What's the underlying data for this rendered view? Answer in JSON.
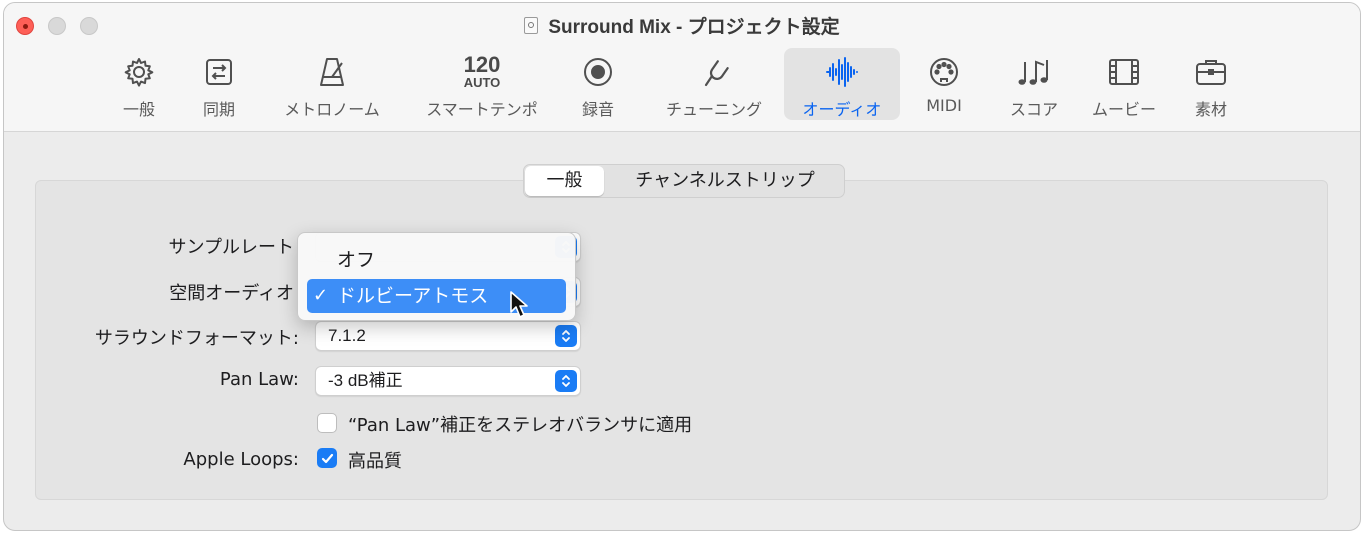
{
  "window": {
    "title": "Surround Mix - プロジェクト設定"
  },
  "toolbar": {
    "tabs": [
      {
        "label": "一般",
        "icon": "gear-icon"
      },
      {
        "label": "同期",
        "icon": "sync-icon"
      },
      {
        "label": "メトロノーム",
        "icon": "metronome-icon"
      },
      {
        "label": "スマートテンポ",
        "icon": "tempo-icon",
        "tempo_value": "120",
        "tempo_mode": "AUTO"
      },
      {
        "label": "録音",
        "icon": "record-icon"
      },
      {
        "label": "チューニング",
        "icon": "tuning-fork-icon"
      },
      {
        "label": "オーディオ",
        "icon": "waveform-icon",
        "active": true
      },
      {
        "label": "MIDI",
        "icon": "midi-connector-icon"
      },
      {
        "label": "スコア",
        "icon": "music-notes-icon"
      },
      {
        "label": "ムービー",
        "icon": "film-icon"
      },
      {
        "label": "素材",
        "icon": "briefcase-icon"
      }
    ]
  },
  "segmented": {
    "options": [
      "一般",
      "チャンネルストリップ"
    ],
    "selected": "一般"
  },
  "form": {
    "sample_rate_label": "サンプルレート",
    "spatial_audio_label": "空間オーディオ",
    "surround_format_label": "サラウンドフォーマット:",
    "surround_format_value": "7.1.2",
    "pan_law_label": "Pan Law:",
    "pan_law_value": "-3 dB補正",
    "pan_law_stereo_label": "“Pan Law”補正をステレオバランサに適用",
    "pan_law_stereo_checked": false,
    "apple_loops_label": "Apple Loops:",
    "high_quality_label": "高品質",
    "high_quality_checked": true
  },
  "dropdown_menu": {
    "items": [
      {
        "label": "オフ",
        "selected": false
      },
      {
        "label": "ドルビーアトモス",
        "selected": true
      }
    ],
    "checkmark": "✓"
  },
  "colors": {
    "accent": "#1a7cf5",
    "active_tab": "#0a64f0",
    "menu_highlight": "#3d8ef7"
  }
}
